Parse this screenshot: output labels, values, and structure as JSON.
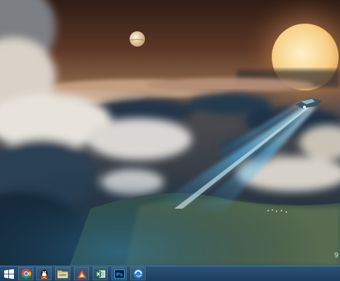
{
  "desktop": {
    "wallpaper": "sci-fi-sky-wallpaper",
    "wallpaper_colors": {
      "sky_top": "#3a2418",
      "sun": "#f6d492",
      "beam": "#6fd0ff",
      "cloud_dark": "#1d3348"
    },
    "corner_text": "9"
  },
  "taskbar": {
    "background": "#1f4466",
    "items": [
      {
        "id": "start",
        "icon": "windows-logo-icon"
      },
      {
        "id": "chrome",
        "icon": "chrome-icon"
      },
      {
        "id": "qq",
        "icon": "qq-penguin-icon"
      },
      {
        "id": "explorer",
        "icon": "file-explorer-icon"
      },
      {
        "id": "app",
        "icon": "triangle-app-icon"
      },
      {
        "id": "excel",
        "icon": "excel-icon"
      },
      {
        "id": "photoshop",
        "icon": "photoshop-icon",
        "label": "Ps"
      },
      {
        "id": "browser",
        "icon": "blue-globe-icon"
      }
    ]
  }
}
